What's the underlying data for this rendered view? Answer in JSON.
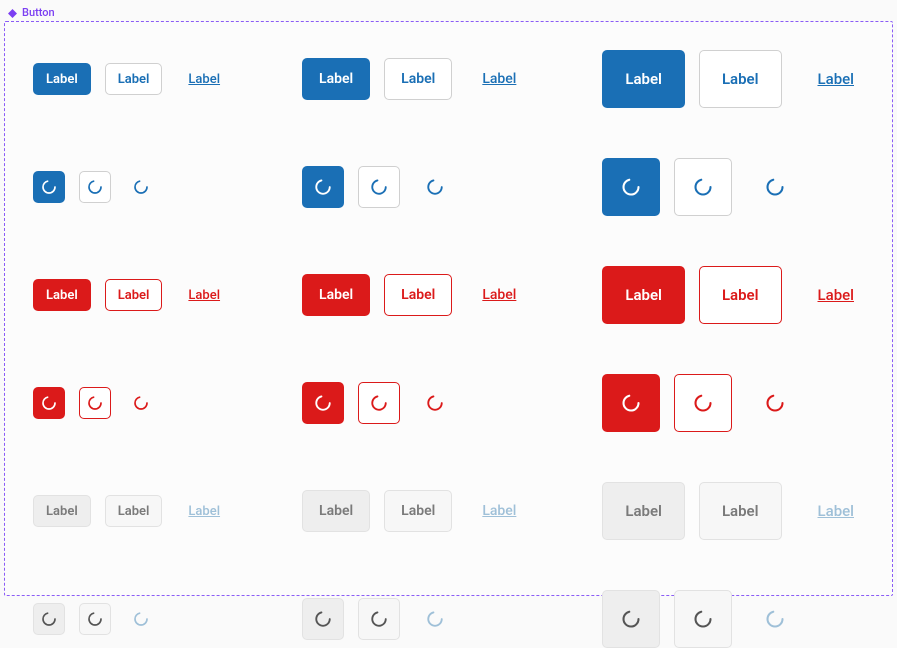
{
  "component": {
    "name": "Button"
  },
  "label": "Label",
  "colors": {
    "primary": "#1a6fb5",
    "danger": "#db1a1a",
    "disabled_fg": "#7a7a7a",
    "disabled_link": "#9fc0d8",
    "spinner_white": "#ffffff",
    "spinner_dark": "#555555"
  }
}
